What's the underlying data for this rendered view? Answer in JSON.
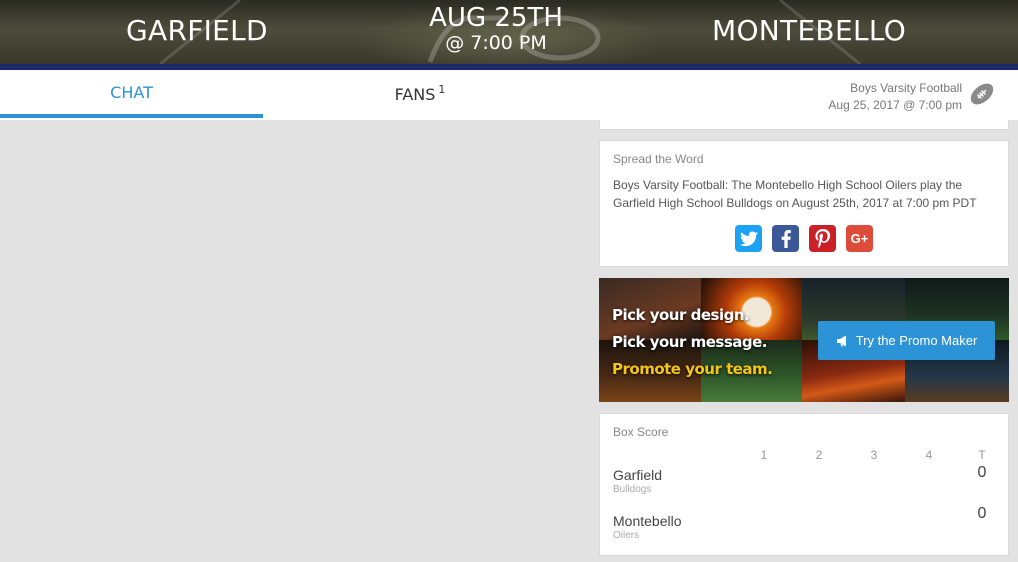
{
  "header": {
    "home_team": "GARFIELD",
    "away_team": "MONTEBELLO",
    "date": "AUG 25TH",
    "time": "@ 7:00 PM"
  },
  "tabs": {
    "chat": "CHAT",
    "fans": "FANS",
    "fans_count": "1"
  },
  "game_info": {
    "sport": "Boys Varsity Football",
    "datetime": "Aug 25, 2017 @ 7:00 pm",
    "icon": "football-icon"
  },
  "spread": {
    "title": "Spread the Word",
    "text": "Boys Varsity Football: The Montebello High School Oilers play the Garfield High School Bulldogs on August 25th, 2017 at 7:00 pm PDT",
    "share": [
      {
        "name": "twitter",
        "icon": "twitter-icon",
        "color": "#1da1f2"
      },
      {
        "name": "facebook",
        "icon": "facebook-icon",
        "color": "#3b5998"
      },
      {
        "name": "pinterest",
        "icon": "pinterest-icon",
        "color": "#cb2027"
      },
      {
        "name": "google-plus",
        "icon": "google-plus-icon",
        "label": "G+",
        "color": "#dd4b39"
      }
    ]
  },
  "promo": {
    "line1": "Pick your design.",
    "line2": "Pick your message.",
    "line3": "Promote your team.",
    "button": "Try the Promo Maker",
    "button_icon": "megaphone-icon",
    "accent": "#f5c518"
  },
  "box_score": {
    "title": "Box Score",
    "periods": [
      "1",
      "2",
      "3",
      "4",
      "T"
    ],
    "teams": [
      {
        "name": "Garfield",
        "mascot": "Bulldogs",
        "total": "0"
      },
      {
        "name": "Montebello",
        "mascot": "Oilers",
        "total": "0"
      }
    ]
  },
  "colors": {
    "accent_blue": "#2b93d6",
    "header_stripe": "#1c2a6b",
    "page_bg": "#e2e2e2"
  }
}
